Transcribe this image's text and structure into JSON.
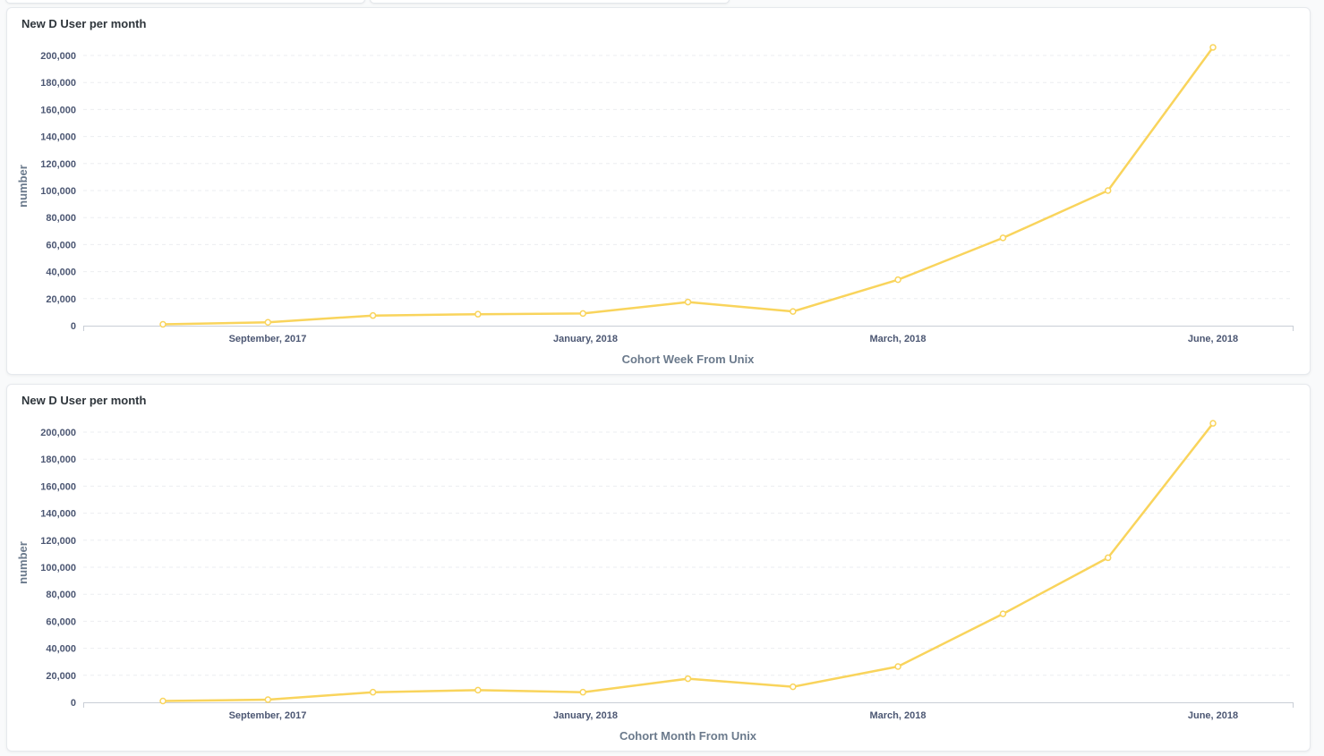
{
  "dashboard": {
    "accent_color": "#f9d45c",
    "cards": [
      {
        "title": "New D User per month",
        "chart_data": {
          "type": "line",
          "title": "New D User per month",
          "xlabel": "Cohort Week From Unix",
          "ylabel": "number",
          "x_tick_labels": [
            "September, 2017",
            "January, 2018",
            "March, 2018",
            "June, 2018"
          ],
          "y_tick_labels": [
            "0",
            "20,000",
            "40,000",
            "60,000",
            "80,000",
            "100,000",
            "120,000",
            "140,000",
            "160,000",
            "180,000",
            "200,000"
          ],
          "ylim": [
            0,
            200000
          ],
          "y_ticks": [
            0,
            20000,
            40000,
            60000,
            80000,
            100000,
            120000,
            140000,
            160000,
            180000,
            200000
          ],
          "grid": true,
          "series": [
            {
              "color": "#f9d45c",
              "values": [
                1000,
                2500,
                7500,
                8500,
                9000,
                17500,
                10500,
                34000,
                65000,
                100000,
                206000
              ]
            }
          ]
        }
      },
      {
        "title": "New D User per month",
        "chart_data": {
          "type": "line",
          "title": "New D User per month",
          "xlabel": "Cohort Month From Unix",
          "ylabel": "number",
          "x_tick_labels": [
            "September, 2017",
            "January, 2018",
            "March, 2018",
            "June, 2018"
          ],
          "y_tick_labels": [
            "0",
            "20,000",
            "40,000",
            "60,000",
            "80,000",
            "100,000",
            "120,000",
            "140,000",
            "160,000",
            "180,000",
            "200,000"
          ],
          "ylim": [
            0,
            200000
          ],
          "y_ticks": [
            0,
            20000,
            40000,
            60000,
            80000,
            100000,
            120000,
            140000,
            160000,
            180000,
            200000
          ],
          "grid": true,
          "series": [
            {
              "color": "#f9d45c",
              "values": [
                1000,
                2000,
                7500,
                9000,
                7500,
                17500,
                11500,
                26500,
                65500,
                107000,
                206500
              ]
            }
          ]
        }
      }
    ]
  }
}
